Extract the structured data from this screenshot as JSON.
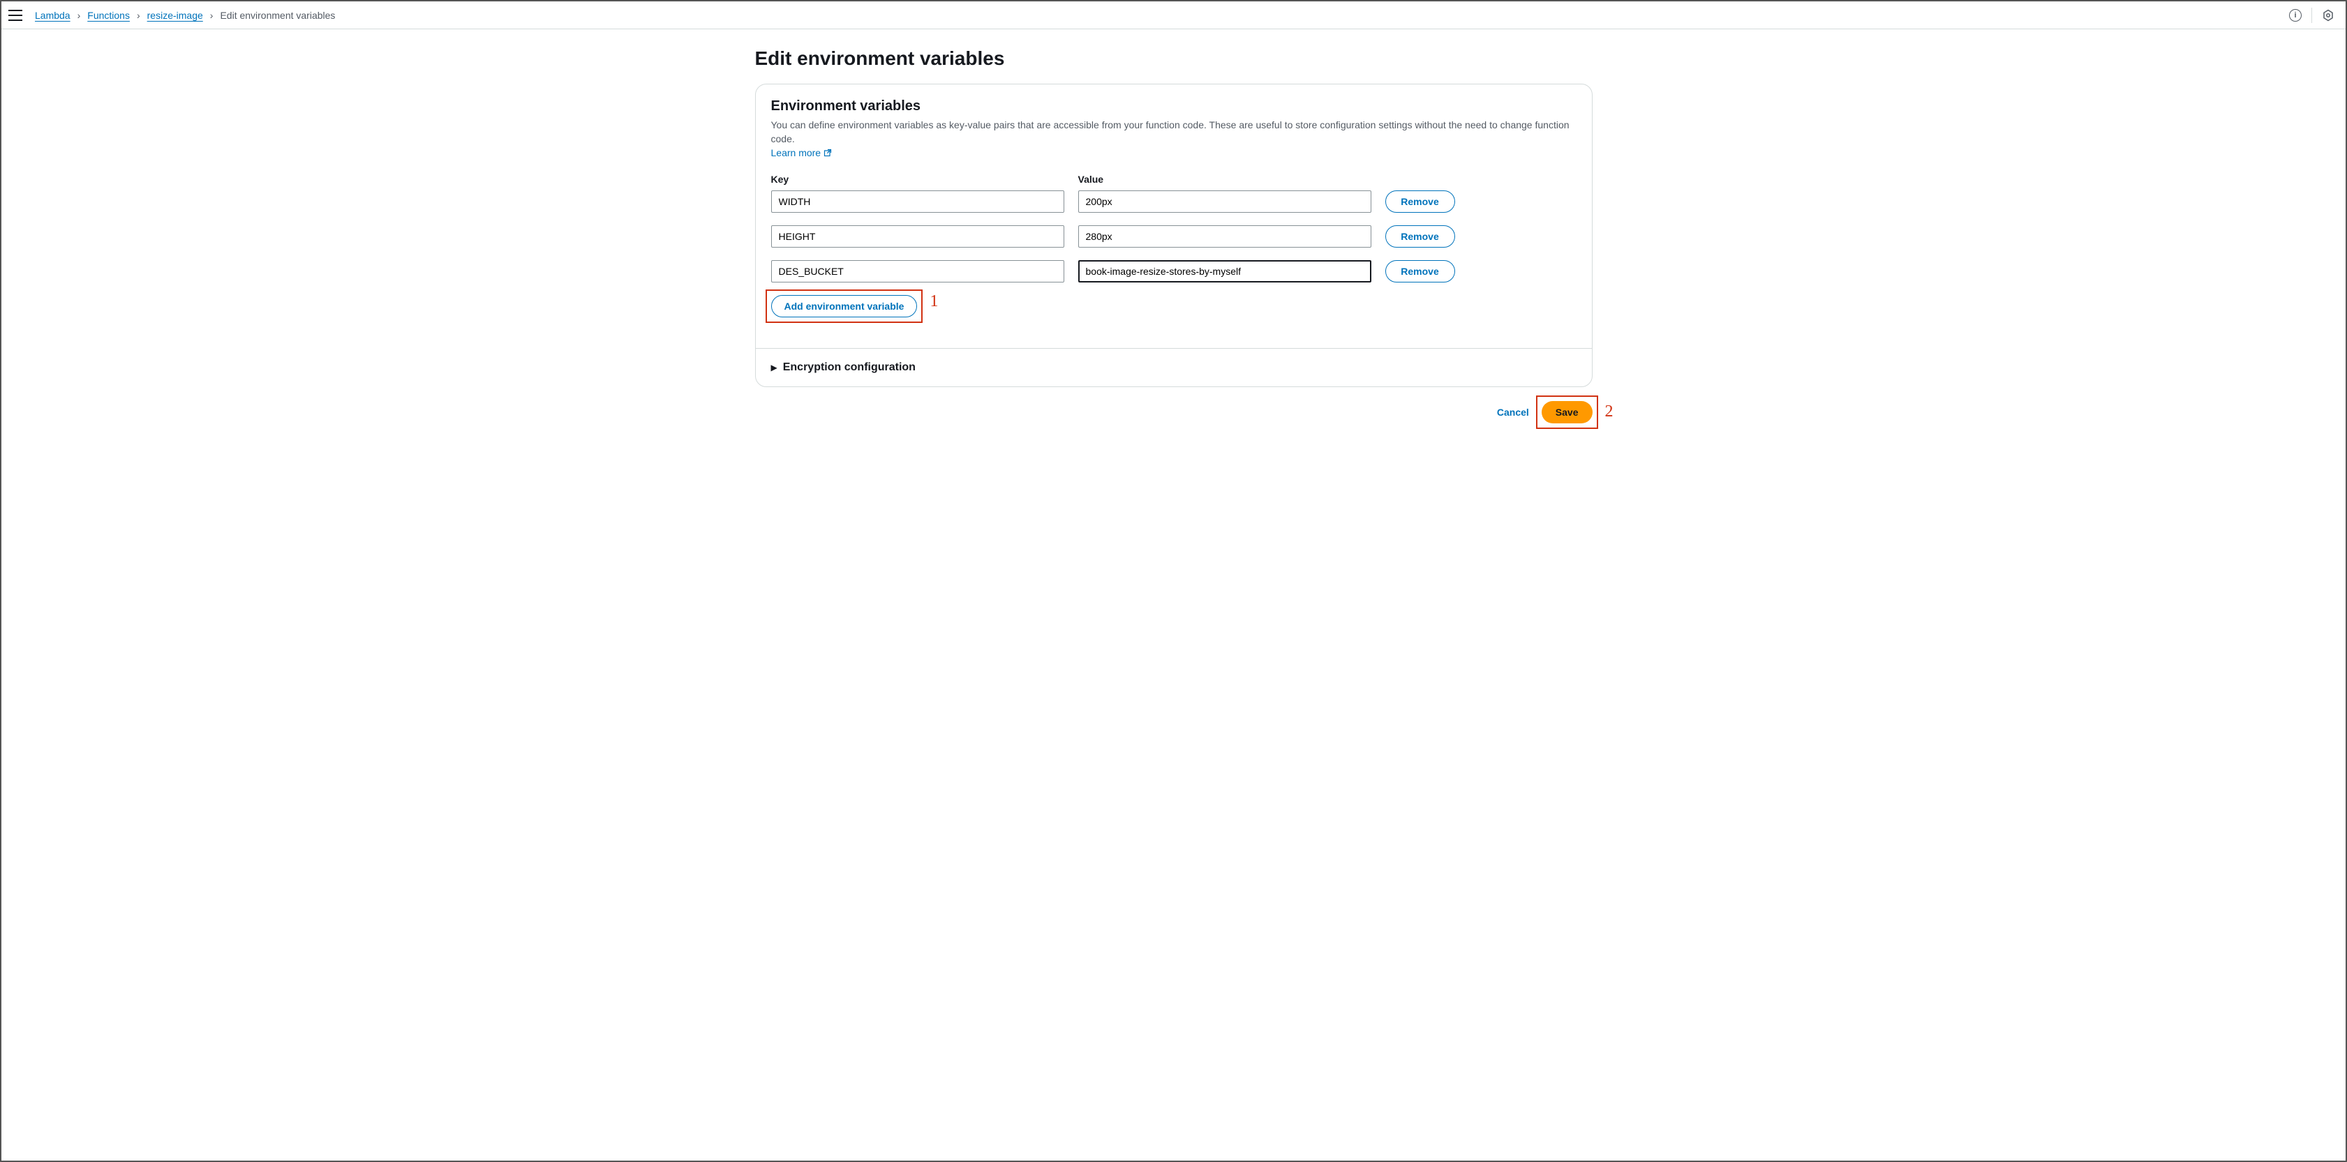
{
  "breadcrumb": {
    "items": [
      "Lambda",
      "Functions",
      "resize-image"
    ],
    "current": "Edit environment variables"
  },
  "page": {
    "title": "Edit environment variables"
  },
  "panel": {
    "title": "Environment variables",
    "description": "You can define environment variables as key-value pairs that are accessible from your function code. These are useful to store configuration settings without the need to change function code.",
    "learn_more": "Learn more",
    "col_key": "Key",
    "col_value": "Value",
    "remove_label": "Remove",
    "add_label": "Add environment variable",
    "rows": [
      {
        "key": "WIDTH",
        "value": "200px"
      },
      {
        "key": "HEIGHT",
        "value": "280px"
      },
      {
        "key": "DES_BUCKET",
        "value": "book-image-resize-stores-by-myself"
      }
    ],
    "encryption_label": "Encryption configuration"
  },
  "actions": {
    "cancel": "Cancel",
    "save": "Save"
  },
  "annotations": {
    "one": "1",
    "two": "2"
  }
}
